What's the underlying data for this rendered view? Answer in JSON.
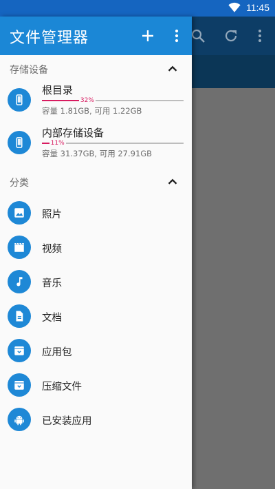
{
  "status_bar": {
    "time": "11:45"
  },
  "drawer": {
    "title": "文件管理器",
    "storage_section": {
      "label": "存储设备",
      "items": [
        {
          "name": "根目录",
          "percent": "32%",
          "fill": 0.32,
          "capacity": "容量 1.81GB, 可用 1.22GB"
        },
        {
          "name": "内部存储设备",
          "percent": "11%",
          "fill": 0.11,
          "capacity": "容量 31.37GB, 可用 27.91GB"
        }
      ]
    },
    "category_section": {
      "label": "分类",
      "items": [
        {
          "label": "照片",
          "icon": "image-icon"
        },
        {
          "label": "视频",
          "icon": "movie-icon"
        },
        {
          "label": "音乐",
          "icon": "music-note-icon"
        },
        {
          "label": "文档",
          "icon": "document-icon"
        },
        {
          "label": "应用包",
          "icon": "archive-box-icon"
        },
        {
          "label": "压缩文件",
          "icon": "archive-box-icon"
        },
        {
          "label": "已安装应用",
          "icon": "android-icon"
        }
      ]
    }
  },
  "colors": {
    "accent": "#1e88d6",
    "header": "#1b87d6",
    "status_bar": "#1565c0",
    "progress": "#d81b60"
  }
}
